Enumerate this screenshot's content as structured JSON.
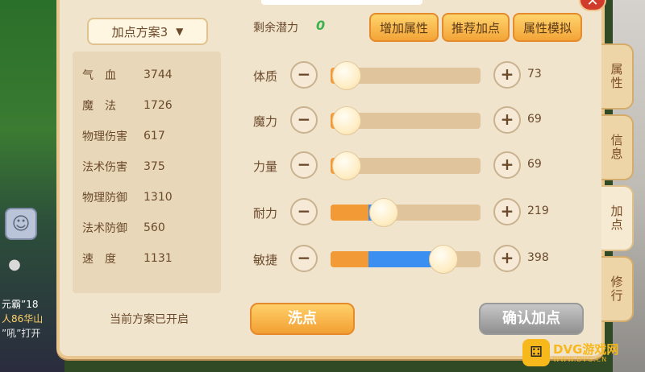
{
  "close_label": "✕",
  "plan_selector": {
    "label": "加点方案3",
    "icon": "chevron-down-icon"
  },
  "stats": [
    {
      "name": "气　血",
      "value": "3744"
    },
    {
      "name": "魔　法",
      "value": "1726"
    },
    {
      "name": "物理伤害",
      "value": "617"
    },
    {
      "name": "法术伤害",
      "value": "375"
    },
    {
      "name": "物理防御",
      "value": "1310"
    },
    {
      "name": "法术防御",
      "value": "560"
    },
    {
      "name": "速　度",
      "value": "1131"
    }
  ],
  "plan_status": "当前方案已开启",
  "potential": {
    "label": "剩余潜力",
    "value": "0"
  },
  "buttons": {
    "add_attr": "增加属性",
    "recommend": "推荐加点",
    "simulate": "属性模拟",
    "wash": "洗点",
    "confirm": "确认加点"
  },
  "attributes": [
    {
      "name": "体质",
      "value": "73",
      "base_fill": 0.11,
      "extra_fill": 0.0
    },
    {
      "name": "魔力",
      "value": "69",
      "base_fill": 0.11,
      "extra_fill": 0.0
    },
    {
      "name": "力量",
      "value": "69",
      "base_fill": 0.11,
      "extra_fill": 0.0
    },
    {
      "name": "耐力",
      "value": "219",
      "base_fill": 0.25,
      "extra_fill": 0.1
    },
    {
      "name": "敏捷",
      "value": "398",
      "base_fill": 0.25,
      "extra_fill": 0.5
    }
  ],
  "side_tabs": [
    {
      "label": "属性",
      "active": false
    },
    {
      "label": "信息",
      "active": false
    },
    {
      "label": "加点",
      "active": true
    },
    {
      "label": "修行",
      "active": false
    }
  ],
  "chat": {
    "line1": "元霸”18",
    "line2": "人86华山",
    "line3": "”吼”打开"
  },
  "watermark": {
    "main": "DVG游戏网",
    "sub": "WWW.DVG.CN"
  },
  "colors": {
    "panel": "#f1e4cd",
    "orange_bar": "#f29a35",
    "blue_bar": "#3b8ff0",
    "potential_green": "#3bb24a"
  }
}
